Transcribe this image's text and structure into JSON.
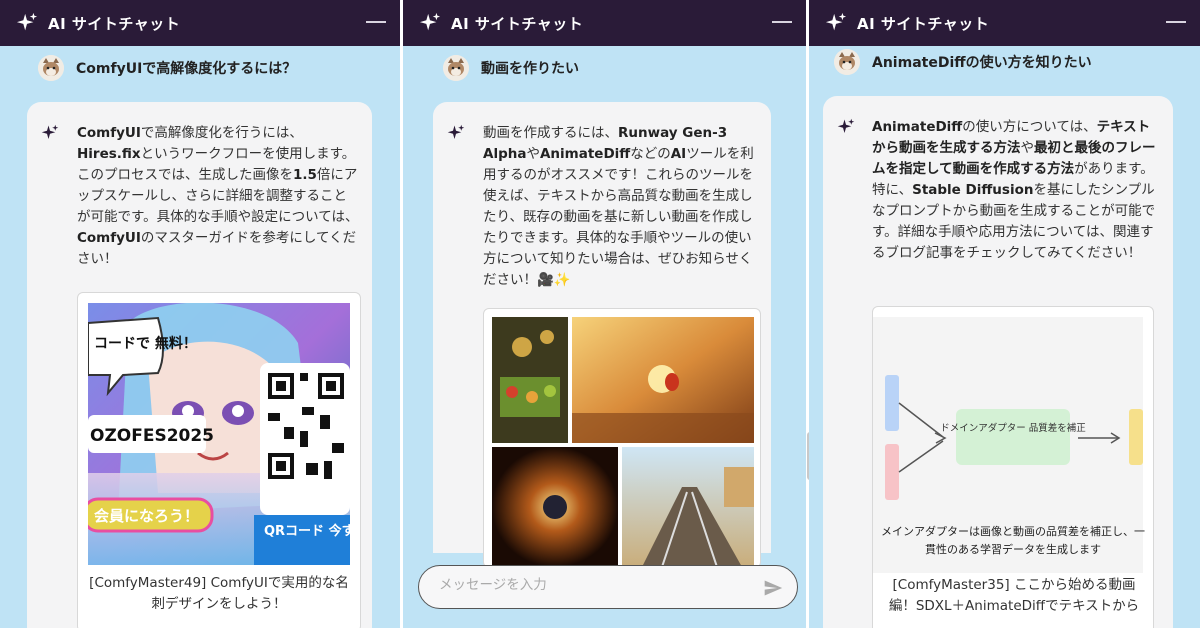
{
  "panels": [
    {
      "header_title": "AI サイトチャット",
      "user_message": "ComfyUIで高解像度化するには？",
      "answer_segments": [
        {
          "t": "ComfyUI",
          "b": true
        },
        {
          "t": "で高解像度化を行うには、",
          "b": false
        },
        {
          "t": "Hires.fix",
          "b": true
        },
        {
          "t": "というワークフローを使用します。このプロセスでは、生成した画像を",
          "b": false
        },
        {
          "t": "1.5",
          "b": true
        },
        {
          "t": "倍にアップスケールし、さらに詳細を調整することが可能です。具体的な手順や設定については、",
          "b": false
        },
        {
          "t": "ComfyUI",
          "b": true
        },
        {
          "t": "のマスターガイドを参考にしてください！",
          "b": false
        }
      ],
      "card": {
        "image_speech_text": "コードで 無料！",
        "image_event_text": "OZOFES2025",
        "image_join_text": "会員になろう！",
        "image_qr_text": "QRコード 今すぐアク",
        "caption": "[ComfyMaster49] ComfyUIで実用的な名刺デザインをしよう！"
      }
    },
    {
      "header_title": "AI サイトチャット",
      "user_message": "動画を作りたい",
      "answer_segments": [
        {
          "t": "動画を作成するには、",
          "b": false
        },
        {
          "t": "Runway Gen-3 Alpha",
          "b": true
        },
        {
          "t": "や",
          "b": false
        },
        {
          "t": "AnimateDiff",
          "b": true
        },
        {
          "t": "などの",
          "b": false
        },
        {
          "t": "AI",
          "b": true
        },
        {
          "t": "ツールを利用するのがオススメです！これらのツールを使えば、テキストから高品質な動画を生成したり、既存の動画を基に新しい動画を作成したりできます。具体的な手順やツールの使い方について知りたい場合は、ぜひお知らせください！🎥✨",
          "b": false
        }
      ],
      "composer_placeholder": "メッセージを入力"
    },
    {
      "header_title": "AI サイトチャット",
      "user_message": "AnimateDiffの使い方を知りたい",
      "answer_segments": [
        {
          "t": "AnimateDiff",
          "b": true
        },
        {
          "t": "の使い方については、",
          "b": false
        },
        {
          "t": "テキストから動画を生成する方法",
          "b": true
        },
        {
          "t": "や",
          "b": false
        },
        {
          "t": "最初と最後のフレームを指定して動画を作成する方法",
          "b": true
        },
        {
          "t": "があります。特に、",
          "b": false
        },
        {
          "t": "Stable Diffusion",
          "b": true
        },
        {
          "t": "を基にしたシンプルなプロンプトから動画を生成することが可能です。詳細な手順や応用方法については、関連するブログ記事をチェックしてみてください！",
          "b": false
        }
      ],
      "card": {
        "diagram_box_text": "ドメインアダプター 品質差を補正",
        "diagram_caption": "メインアダプターは画像と動画の品質差を補正し、一貫性のある学習データを生成します",
        "caption": "[ComfyMaster35] ここから始める動画編！SDXL＋AnimateDiffでテキストから"
      }
    }
  ],
  "colors": {
    "header_bg": "#2a1b38",
    "page_bg": "#bfe3f5",
    "bubble_bg": "#f4f4f5",
    "spark": "#2a1b38"
  },
  "icons": [
    "sparkle-icon",
    "minimize-icon",
    "avatar-cat-icon",
    "send-icon"
  ]
}
